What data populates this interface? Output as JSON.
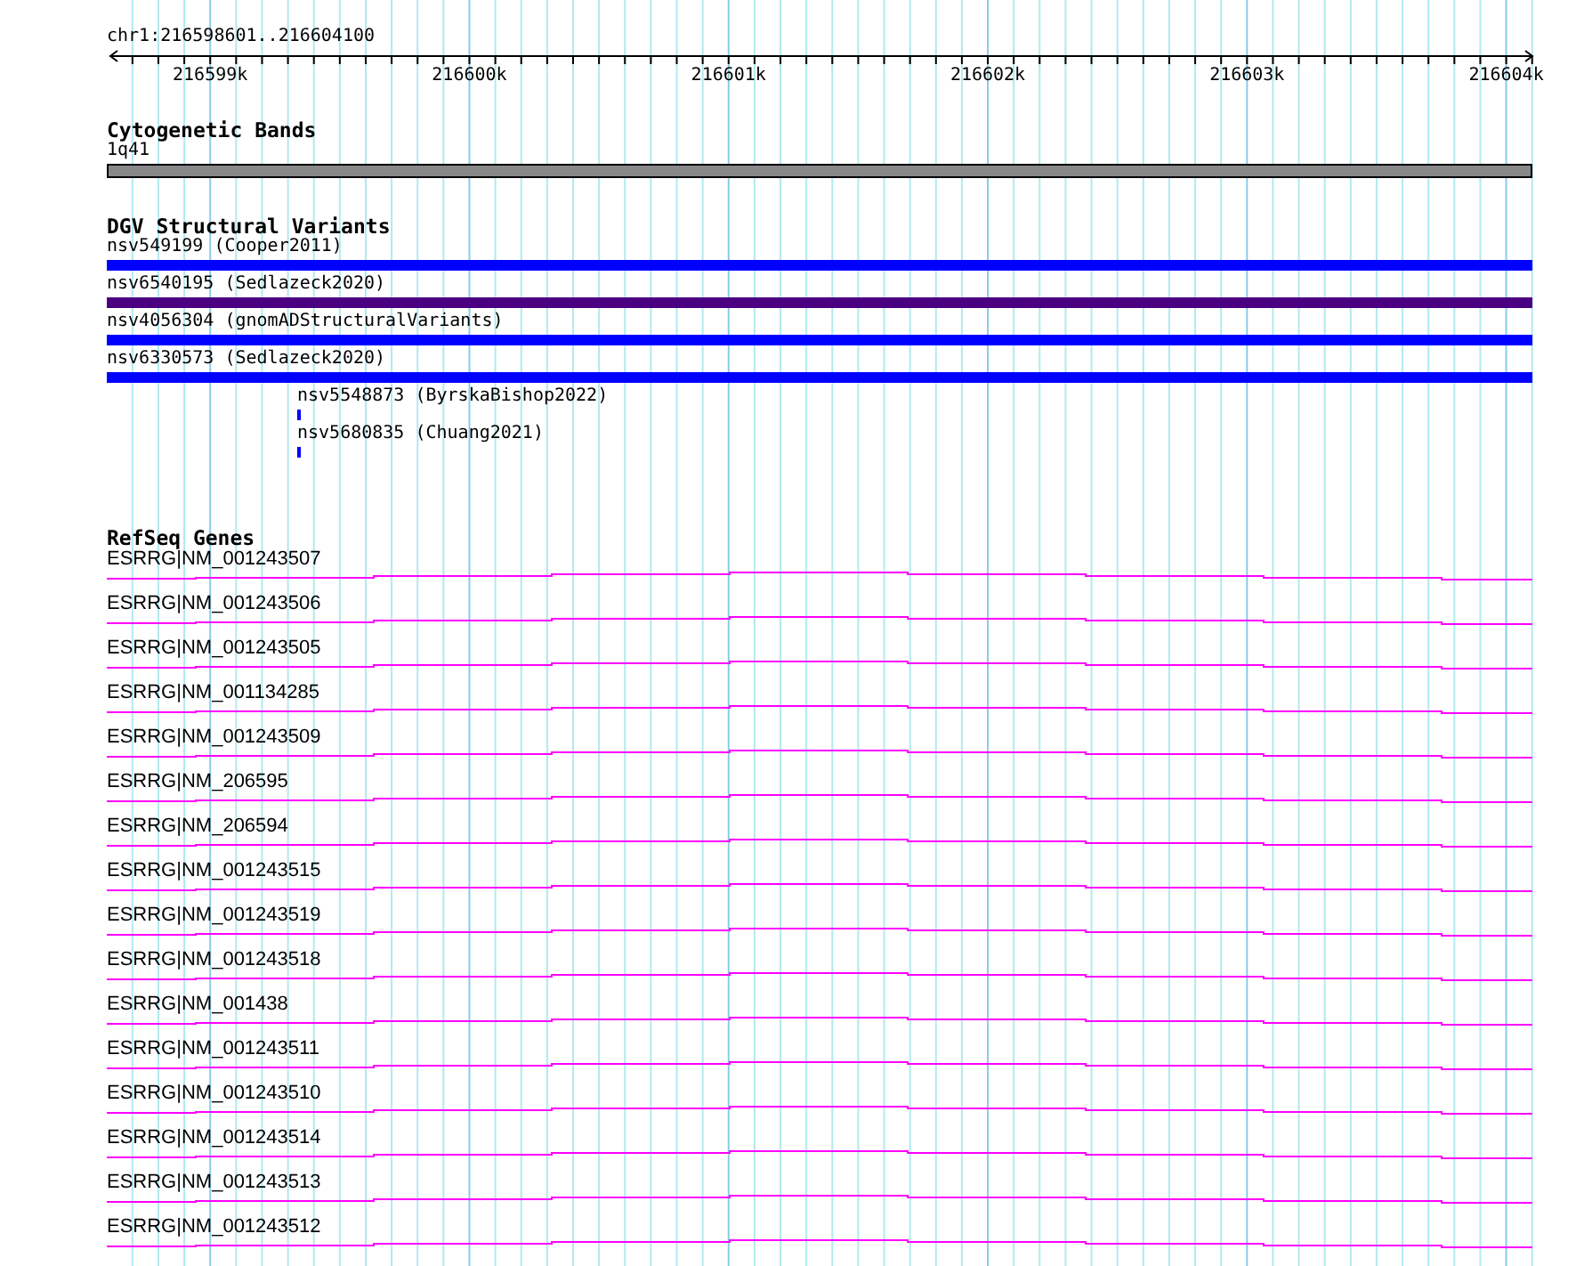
{
  "ruler": {
    "location": "chr1:216598601..216604100",
    "ticks": [
      "216599k",
      "216600k",
      "216601k",
      "216602k",
      "216603k",
      "216604k"
    ]
  },
  "tracks": [
    {
      "kind": "cytoband",
      "title": "Cytogenetic Bands",
      "features": [
        {
          "label": "1q41"
        }
      ]
    },
    {
      "kind": "variants",
      "title": "DGV Structural Variants",
      "features": [
        {
          "label": "nsv549199 (Cooper2011)",
          "kind": "long",
          "color": "#0000ff"
        },
        {
          "label": "nsv6540195 (Sedlazeck2020)",
          "kind": "long",
          "color": "#4b0082"
        },
        {
          "label": "nsv4056304 (gnomADStructuralVariants)",
          "kind": "long",
          "color": "#0000ff"
        },
        {
          "label": "nsv6330573 (Sedlazeck2020)",
          "kind": "long",
          "color": "#0000ff"
        },
        {
          "label": "nsv5548873 (ByrskaBishop2022)",
          "kind": "short",
          "color": "#0000ff"
        },
        {
          "label": "nsv5680835 (Chuang2021)",
          "kind": "short",
          "color": "#0000ff"
        }
      ]
    },
    {
      "kind": "genes",
      "title": "RefSeq Genes",
      "features": [
        {
          "label": "ESRRG|NM_001243507"
        },
        {
          "label": "ESRRG|NM_001243506"
        },
        {
          "label": "ESRRG|NM_001243505"
        },
        {
          "label": "ESRRG|NM_001134285"
        },
        {
          "label": "ESRRG|NM_001243509"
        },
        {
          "label": "ESRRG|NM_206595"
        },
        {
          "label": "ESRRG|NM_206594"
        },
        {
          "label": "ESRRG|NM_001243515"
        },
        {
          "label": "ESRRG|NM_001243519"
        },
        {
          "label": "ESRRG|NM_001243518"
        },
        {
          "label": "ESRRG|NM_001438"
        },
        {
          "label": "ESRRG|NM_001243511"
        },
        {
          "label": "ESRRG|NM_001243510"
        },
        {
          "label": "ESRRG|NM_001243514"
        },
        {
          "label": "ESRRG|NM_001243513"
        },
        {
          "label": "ESRRG|NM_001243512"
        }
      ]
    }
  ]
}
